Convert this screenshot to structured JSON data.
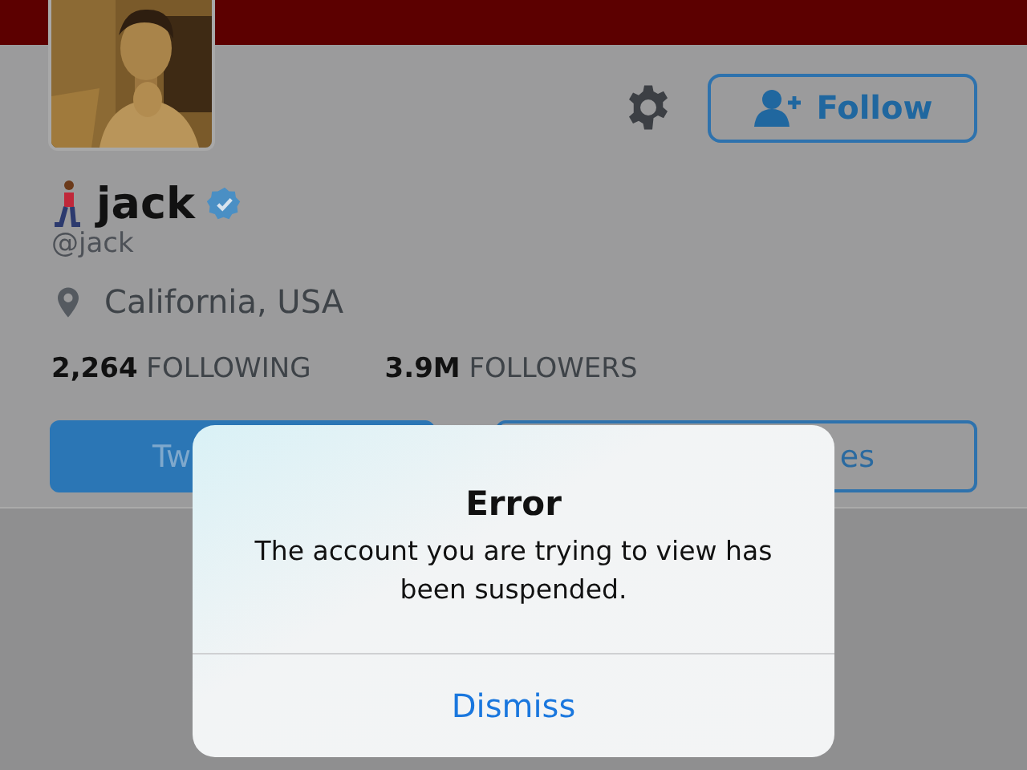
{
  "profile": {
    "name": "jack",
    "verified": true,
    "handle": "@jack",
    "location": "California, USA",
    "follow_button": "Follow"
  },
  "stats": [
    {
      "text": "**2,264** FOLLOWING"
    },
    {
      "text": "**3.9M** FOLLOWERS"
    }
  ],
  "tabs": [
    {
      "label": "Tw",
      "selected": true
    },
    {
      "label": "es",
      "selected": false
    }
  ],
  "alert": {
    "title": "Error",
    "message": "The account you are trying to view has been suspended.",
    "button": "Dismiss"
  }
}
